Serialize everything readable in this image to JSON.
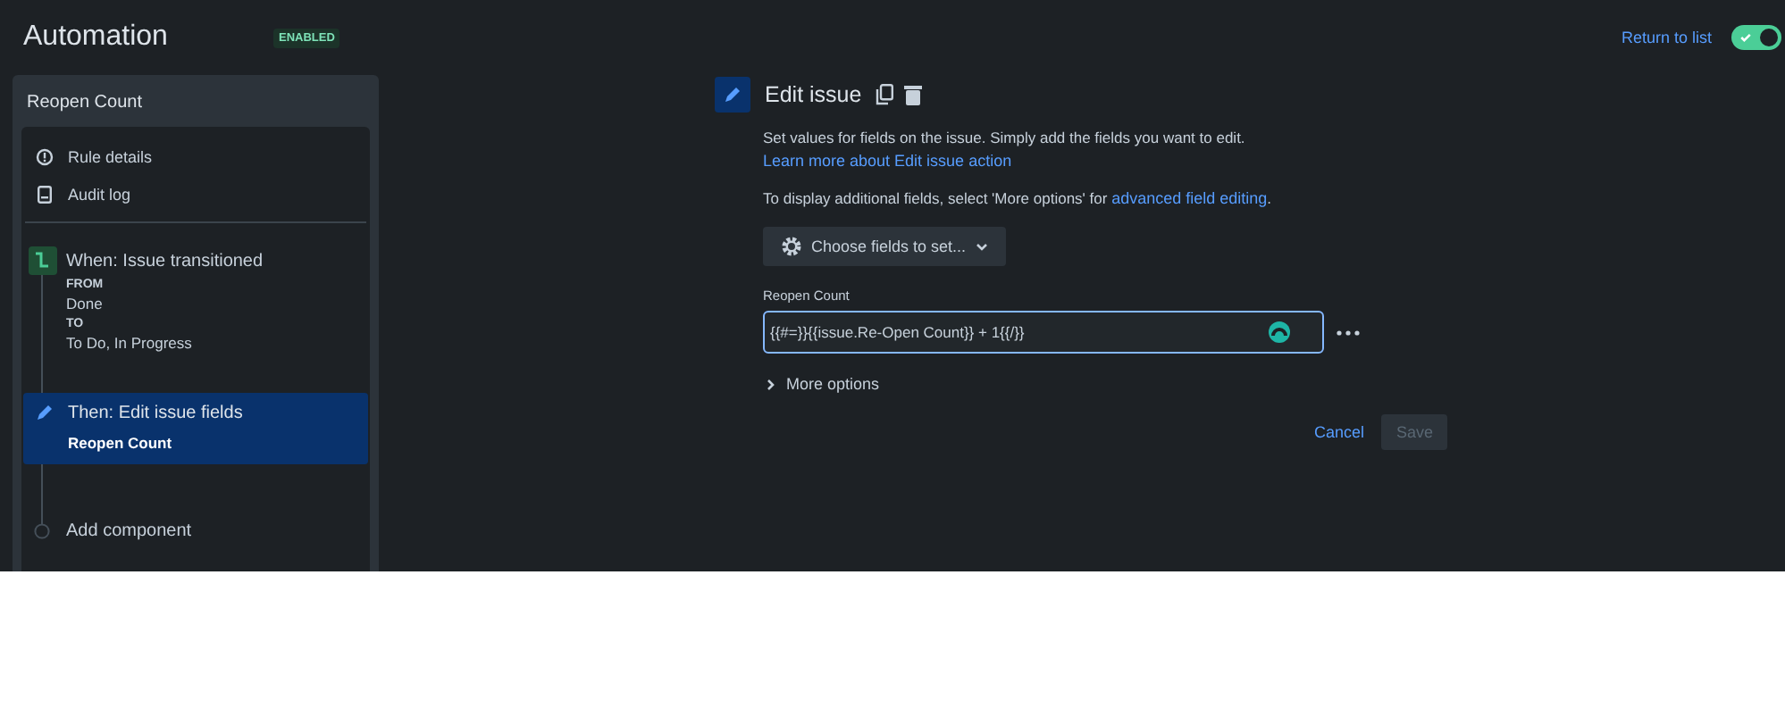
{
  "header": {
    "title": "Automation",
    "status_badge": "ENABLED",
    "return_link": "Return to list",
    "toggle": {
      "on": true
    }
  },
  "sidebar": {
    "rule_name": "Reopen Count",
    "menu": [
      {
        "kind": "info",
        "label": "Rule details"
      },
      {
        "kind": "log",
        "label": "Audit log"
      }
    ],
    "steps": [
      {
        "kind": "trigger",
        "title": "When: Issue transitioned",
        "selected": false,
        "details": [
          {
            "text": "FROM",
            "bold": true
          },
          {
            "text": "Done",
            "bold": false
          },
          {
            "text": "TO",
            "bold": true
          },
          {
            "text": "To Do, In Progress",
            "bold": false
          }
        ]
      },
      {
        "kind": "action",
        "title": "Then: Edit issue fields",
        "selected": true,
        "details": [
          {
            "text": "Reopen Count",
            "bold": true
          }
        ]
      },
      {
        "kind": "add",
        "title": "Add component",
        "selected": false
      }
    ]
  },
  "editor": {
    "title": "Edit issue",
    "description": "Set values for fields on the issue. Simply add the fields you want to edit.",
    "description_link": "Learn more about Edit issue action",
    "hint": "To display additional fields, select 'More options' for",
    "hint_link": "advanced field editing",
    "hint_end": ".",
    "choose_button": "Choose fields to set...",
    "field": {
      "label": "Reopen Count",
      "value": "{{#=}}{{issue.Re-Open Count}} + 1{{/}}"
    },
    "more_options": {
      "label": "More options",
      "expanded": false
    },
    "cancel": "Cancel",
    "save": {
      "label": "Save",
      "disabled": true
    }
  }
}
